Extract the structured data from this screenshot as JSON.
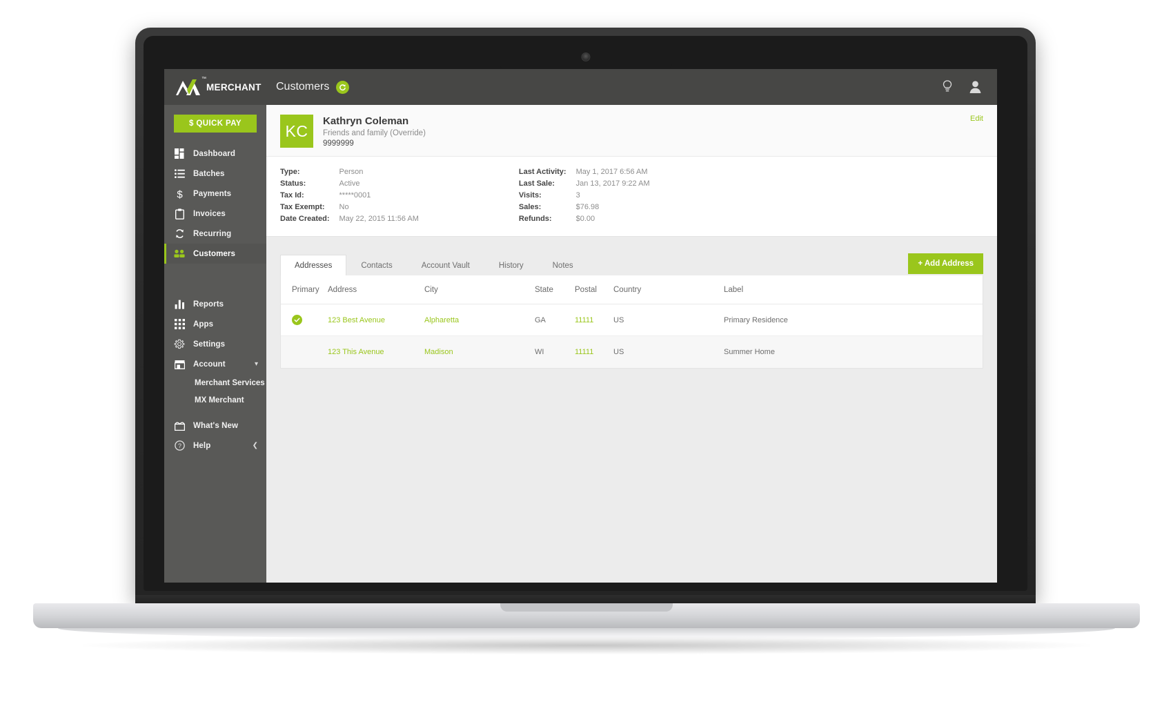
{
  "topbar": {
    "brand_text": "MERCHANT",
    "brand_tm": "™",
    "page_title": "Customers",
    "refresh_icon": "refresh-icon",
    "lightbulb_icon": "lightbulb-icon",
    "user_icon": "user-icon"
  },
  "sidebar": {
    "quick_pay_label": "$ QUICK PAY",
    "items": [
      {
        "label": "Dashboard",
        "icon": "dashboard-icon",
        "active": false
      },
      {
        "label": "Batches",
        "icon": "list-icon",
        "active": false
      },
      {
        "label": "Payments",
        "icon": "dollar-icon",
        "active": false
      },
      {
        "label": "Invoices",
        "icon": "clipboard-icon",
        "active": false
      },
      {
        "label": "Recurring",
        "icon": "refresh-icon",
        "active": false
      },
      {
        "label": "Customers",
        "icon": "people-icon",
        "active": true
      }
    ],
    "items_lower": [
      {
        "label": "Reports",
        "icon": "bar-chart-icon",
        "active": false
      },
      {
        "label": "Apps",
        "icon": "grid-icon",
        "active": false
      },
      {
        "label": "Settings",
        "icon": "gear-icon",
        "active": false
      },
      {
        "label": "Account",
        "icon": "store-icon",
        "active": false,
        "chevron": "chevron-down-icon"
      }
    ],
    "account_subitems": [
      {
        "label": "Merchant Services"
      },
      {
        "label": "MX Merchant"
      }
    ],
    "items_bottom": [
      {
        "label": "What's New",
        "icon": "gift-icon",
        "active": false
      },
      {
        "label": "Help",
        "icon": "help-icon",
        "active": false,
        "chevron": "chevron-left-icon"
      }
    ]
  },
  "customer": {
    "initials": "KC",
    "name": "Kathryn Coleman",
    "group": "Friends and family (Override)",
    "customer_number": "9999999",
    "edit_label": "Edit",
    "left_fields": [
      {
        "key": "Type:",
        "value": "Person"
      },
      {
        "key": "Status:",
        "value": "Active"
      },
      {
        "key": "Tax Id:",
        "value": "*****0001"
      },
      {
        "key": "Tax Exempt:",
        "value": "No"
      },
      {
        "key": "Date Created:",
        "value": "May 22, 2015 11:56 AM"
      }
    ],
    "right_fields": [
      {
        "key": "Last Activity:",
        "value": "May 1, 2017 6:56 AM"
      },
      {
        "key": "Last Sale:",
        "value": "Jan 13, 2017 9:22 AM"
      },
      {
        "key": "Visits:",
        "value": "3"
      },
      {
        "key": "Sales:",
        "value": "$76.98"
      },
      {
        "key": "Refunds:",
        "value": "$0.00"
      }
    ]
  },
  "tabs": [
    {
      "label": "Addresses",
      "active": true
    },
    {
      "label": "Contacts",
      "active": false
    },
    {
      "label": "Account Vault",
      "active": false
    },
    {
      "label": "History",
      "active": false
    },
    {
      "label": "Notes",
      "active": false
    }
  ],
  "add_address_label": "+ Add Address",
  "address_table": {
    "columns": [
      "Primary",
      "Address",
      "City",
      "State",
      "Postal",
      "Country",
      "Label"
    ],
    "rows": [
      {
        "primary": true,
        "address": "123 Best Avenue",
        "city": "Alpharetta",
        "state": "GA",
        "postal": "11111",
        "country": "US",
        "label": "Primary Residence"
      },
      {
        "primary": false,
        "address": "123 This Avenue",
        "city": "Madison",
        "state": "WI",
        "postal": "11111",
        "country": "US",
        "label": "Summer Home"
      }
    ]
  },
  "colors": {
    "accent_green": "#9ac61c",
    "sidebar": "#595957",
    "topbar": "#474745"
  }
}
